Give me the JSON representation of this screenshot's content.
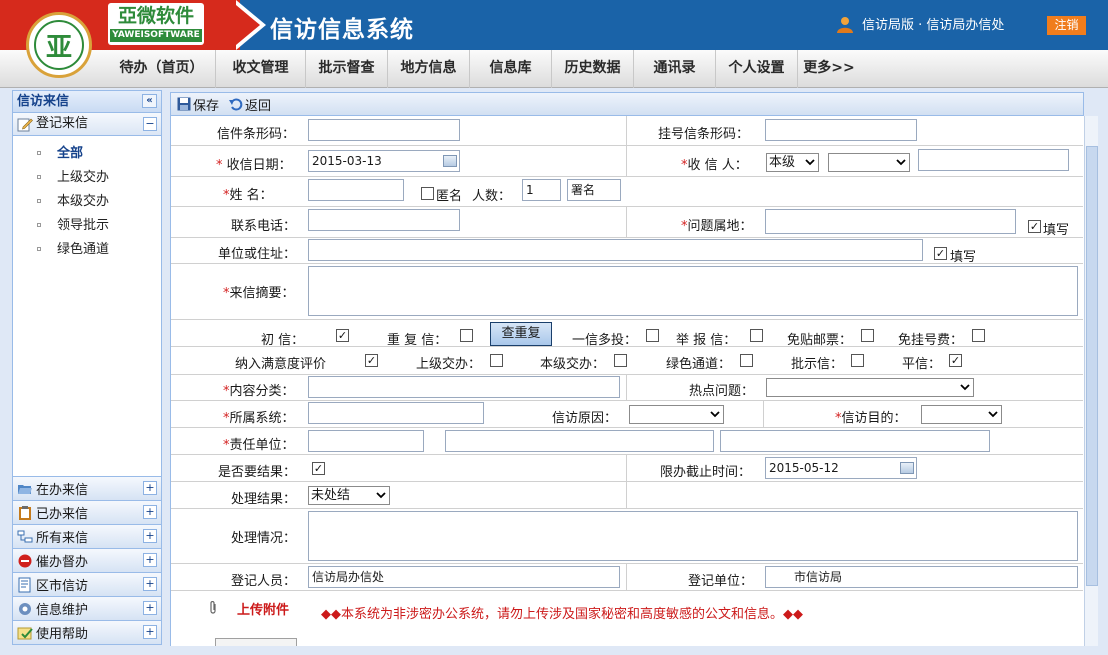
{
  "header": {
    "company_cn": "亞微软件",
    "company_en": "YAWEISOFTWARE",
    "logo_mark": "亚",
    "system_title": "信访信息系统",
    "user_text": "信访局版 · 信访局办信处",
    "logout_label": "注销"
  },
  "nav": [
    "待办（首页）",
    "收文管理",
    "批示督查",
    "地方信息",
    "信息库",
    "历史数据",
    "通讯录",
    "个人设置",
    "更多>>"
  ],
  "sidebar": {
    "title": "信访来信",
    "collapse_symbol": "«",
    "group": "登记来信",
    "group_toggle": "−",
    "items": [
      "全部",
      "上级交办",
      "本级交办",
      "领导批示",
      "绿色通道"
    ],
    "panels": [
      {
        "label": "在办来信",
        "icon": "folder-open-icon",
        "color": "#3a6fb0"
      },
      {
        "label": "已办来信",
        "icon": "clipboard-icon",
        "color": "#c47a1c"
      },
      {
        "label": "所有来信",
        "icon": "tree-icon",
        "color": "#3a6fb0"
      },
      {
        "label": "催办督办",
        "icon": "alert-icon",
        "color": "#d0201c"
      },
      {
        "label": "区市信访",
        "icon": "document-icon",
        "color": "#3a6fb0"
      },
      {
        "label": "信息维护",
        "icon": "gear-icon",
        "color": "#3a6fb0"
      },
      {
        "label": "使用帮助",
        "icon": "help-icon",
        "color": "#2e8b3a"
      }
    ],
    "panel_toggle": "+"
  },
  "toolbar": {
    "save_label": "保存",
    "back_label": "返回"
  },
  "form": {
    "barcode_label": "信件条形码：",
    "registered_barcode_label": "挂号信条形码：",
    "receive_date_label": "收信日期：",
    "receive_date_value": "2015-03-13",
    "receiver_label": "收 信 人：",
    "receiver_level": "本级",
    "name_label": "姓      名：",
    "anonymous_label": "匿名",
    "count_label": "人数：",
    "count_value": "1",
    "signed_value": "署名",
    "phone_label": "联系电话：",
    "location_label": "问题属地：",
    "fill_label": "填写",
    "address_label": "单位或住址：",
    "fill_label2": "填写",
    "summary_label": "来信摘要：",
    "req_mark": "*",
    "checks_row1": [
      {
        "label": "初      信：",
        "checked": true
      },
      {
        "label": "重 复 信：",
        "checked": false
      },
      {
        "label": "一信多投：",
        "checked": false
      },
      {
        "label": "举 报 信：",
        "checked": false
      },
      {
        "label": "免贴邮票：",
        "checked": false
      },
      {
        "label": "免挂号费：",
        "checked": false
      }
    ],
    "dup_button": "查重复",
    "checks_row2": [
      {
        "label": "纳入满意度评价",
        "checked": true
      },
      {
        "label": "上级交办：",
        "checked": false
      },
      {
        "label": "本级交办：",
        "checked": false
      },
      {
        "label": "绿色通道：",
        "checked": false
      },
      {
        "label": "批示信：",
        "checked": false
      },
      {
        "label": "平信：",
        "checked": true
      }
    ],
    "content_class_label": "内容分类：",
    "hot_issue_label": "热点问题：",
    "system_label": "所属系统：",
    "reason_label": "信访原因：",
    "purpose_label": "信访目的：",
    "unit_label": "责任单位：",
    "need_result_label": "是否要结果：",
    "deadline_label": "限办截止时间：",
    "deadline_value": "2015-05-12",
    "result_label": "处理结果：",
    "result_value": "未处结",
    "situation_label": "处理情况：",
    "registrant_label": "登记人员：",
    "registrant_value": "信访局办信处",
    "reg_unit_label": "登记单位：",
    "reg_unit_value": "市信访局",
    "upload_label": "上传附件",
    "notice": "◆◆本系统为非涉密办公系统，请勿上传涉及国家秘密和高度敏感的公文和信息。◆◆"
  },
  "colors": {
    "header_blue": "#1a63a8",
    "brand_red": "#d62a1c",
    "logout_orange": "#f07d1d",
    "required_red": "#d32020"
  }
}
